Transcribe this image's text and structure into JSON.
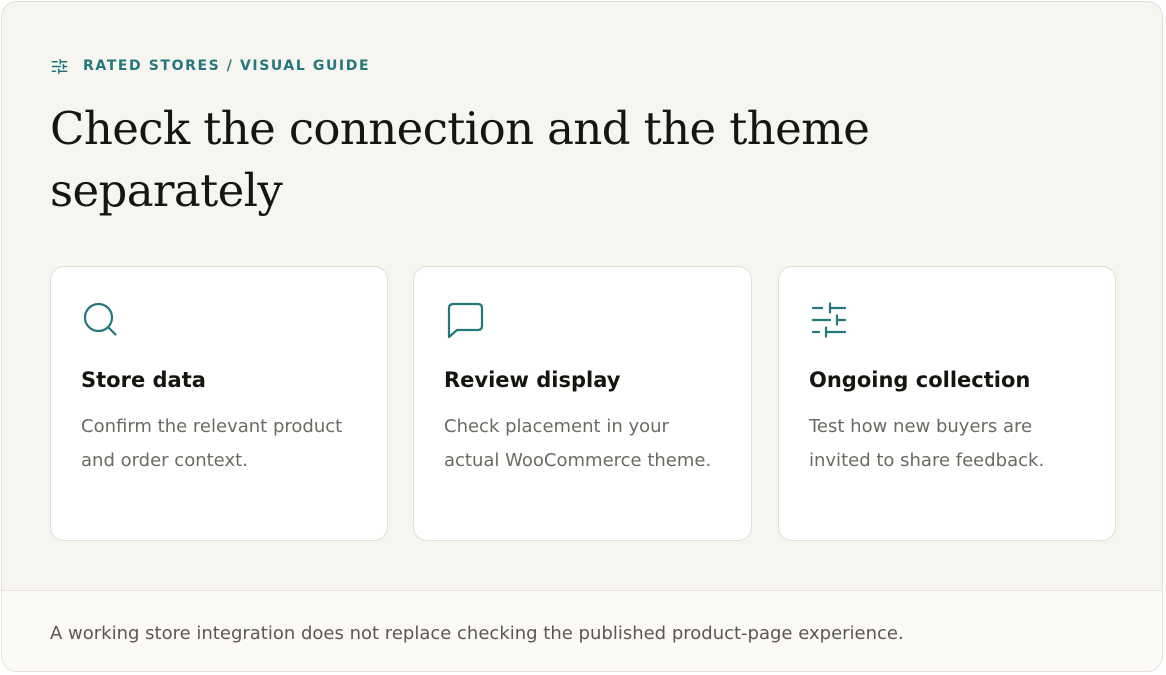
{
  "header": {
    "eyebrow_icon": "sliders-icon",
    "eyebrow": "RATED STORES / VISUAL GUIDE",
    "title": "Check the connection and the theme separately"
  },
  "cards": [
    {
      "icon": "search-icon",
      "title": "Store data",
      "description": "Confirm the relevant product and order context."
    },
    {
      "icon": "chat-bubble-icon",
      "title": "Review display",
      "description": "Check placement in your actual WooCommerce theme."
    },
    {
      "icon": "sliders-icon",
      "title": "Ongoing collection",
      "description": "Test how new buyers are invited to share feedback."
    }
  ],
  "footer": {
    "note": "A working store integration does not replace checking the published product-page experience."
  },
  "colors": {
    "accent": "#23777d",
    "background": "#f6f5f0",
    "card": "#ffffff",
    "border": "#e2dfd6",
    "text_primary": "#16140f",
    "text_muted": "#6d6a63"
  }
}
